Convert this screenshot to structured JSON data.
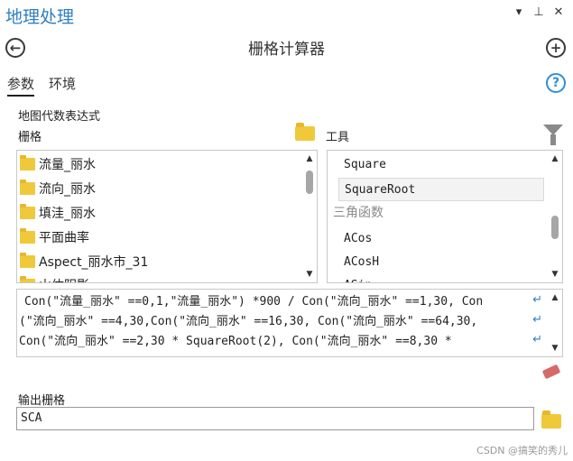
{
  "pane": {
    "title": "地理处理",
    "controls": {
      "dropdown": "▾",
      "pin": "⊥",
      "close": "✕"
    }
  },
  "header": {
    "tool_title": "栅格计算器",
    "back_glyph": "←",
    "add_glyph": "+"
  },
  "tabs": [
    {
      "label": "参数"
    },
    {
      "label": "环境"
    }
  ],
  "help_glyph": "?",
  "section": {
    "map_algebra_label": "地图代数表达式",
    "rasters_label": "栅格",
    "tools_label": "工具"
  },
  "rasters": [
    {
      "label": "流量_丽水"
    },
    {
      "label": "流向_丽水"
    },
    {
      "label": "填洼_丽水"
    },
    {
      "label": "平面曲率"
    },
    {
      "label": "Aspect_丽水市_31"
    },
    {
      "label": "山体阴影"
    }
  ],
  "tools": [
    {
      "label": "Square"
    },
    {
      "label": "SquareRoot"
    },
    {
      "label": "三角函数"
    },
    {
      "label": "ACos"
    },
    {
      "label": "ACosH"
    },
    {
      "label": "ASin"
    }
  ],
  "expression": {
    "lines": [
      "Con(\"流量_丽水\" ==0,1,\"流量_丽水\") *900 / Con(\"流向_丽水\" ==1,30, Con",
      "(\"流向_丽水\" ==4,30,Con(\"流向_丽水\" ==16,30, Con(\"流向_丽水\" ==64,30,",
      "Con(\"流向_丽水\" ==2,30 * SquareRoot(2), Con(\"流向_丽水\" ==8,30 *"
    ],
    "wrap_glyph": "↵"
  },
  "output": {
    "label": "输出栅格",
    "value": "SCA"
  },
  "watermark": "CSDN @搞笑的秀儿",
  "colors": {
    "accent": "#2f7fc1",
    "folder": "#f0c93a"
  }
}
